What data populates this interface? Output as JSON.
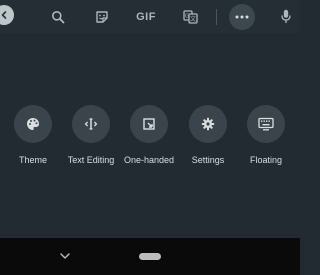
{
  "toolbar": {
    "back_icon": "chevron-left-icon",
    "search_icon": "search-icon",
    "sticker_icon": "sticker-icon",
    "gif_label": "GIF",
    "translate_icon": "translate-icon",
    "more_icon": "more-horizontal-icon",
    "mic_icon": "microphone-icon"
  },
  "options": [
    {
      "label": "Theme",
      "icon": "palette-icon"
    },
    {
      "label": "Text Editing",
      "icon": "text-cursor-icon"
    },
    {
      "label": "One-handed",
      "icon": "one-handed-icon"
    },
    {
      "label": "Settings",
      "icon": "gear-icon"
    },
    {
      "label": "Floating",
      "icon": "floating-keyboard-icon"
    }
  ],
  "navbar": {
    "back_icon": "chevron-down-icon",
    "home_icon": "home-pill-icon"
  },
  "colors": {
    "background": "#212b31",
    "toolbar": "#252e34",
    "circle": "#3a444a",
    "text": "#d9dee1",
    "navbar": "#0a0a0a"
  }
}
